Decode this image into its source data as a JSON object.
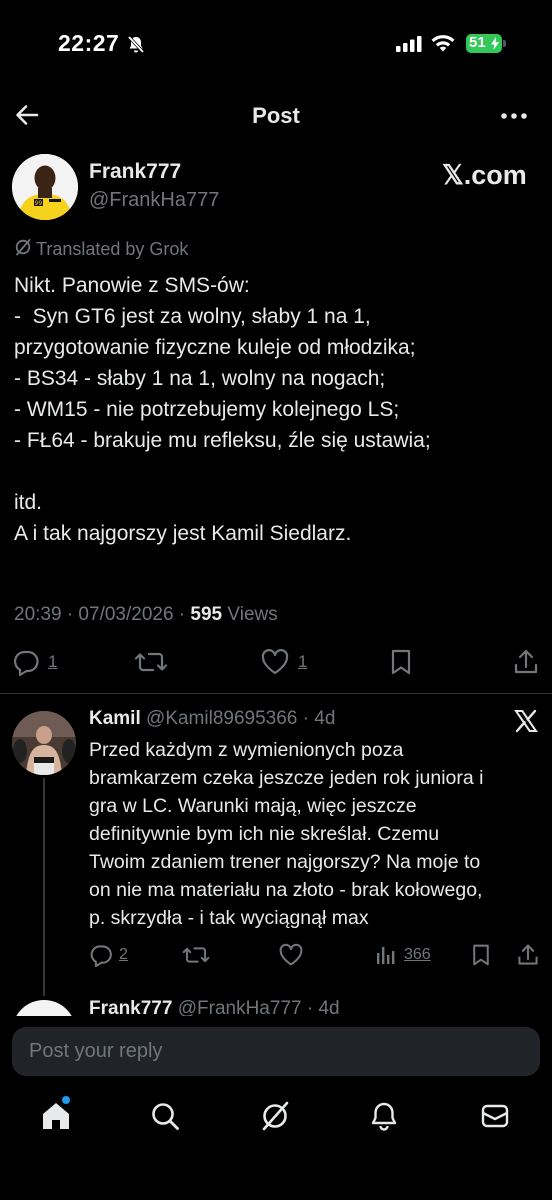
{
  "status_bar": {
    "time": "22:27",
    "battery": "51"
  },
  "header": {
    "title": "Post"
  },
  "post": {
    "author_name": "Frank777",
    "author_handle": "@FrankHa777",
    "source_badge": "𝕏.com",
    "translated_label": "Translated by Grok",
    "lines": [
      "Nikt. Panowie z SMS-ów:",
      "-  Syn GT6 jest za wolny, słaby 1 na 1,",
      "przygotowanie fizyczne kuleje od młodzika;",
      "- BS34 - słaby 1 na 1, wolny na nogach;",
      "- WM15 - nie potrzebujemy kolejnego LS;",
      "- FŁ64 - brakuje mu refleksu, źle się ustawia;",
      "",
      "itd.",
      "A i tak najgorszy jest Kamil Siedlarz."
    ],
    "timestamp": "20:39 · 07/03/2026 · ",
    "views_count": "595",
    "views_label": " Views",
    "reply_count": "1",
    "like_count": "1"
  },
  "reply": {
    "name": "Kamil",
    "handle_time": " @Kamil89695366 · 4d",
    "lines": [
      "Przed każdym z wymienionych poza",
      "bramkarzem czeka jeszcze jeden rok juniora i",
      "gra w LC. Warunki mają, więc jeszcze",
      "definitywnie bym ich nie skreślał. Czemu",
      "Twoim zdaniem trener najgorszy? Na moje to",
      "on nie ma materiału na złoto - brak kołowego,",
      "p. skrzydła - i tak wyciągnął max"
    ],
    "reply_count": "2",
    "views": "366"
  },
  "next_reply": {
    "name": "Frank777",
    "handle_time": " @FrankHa777 · 4d"
  },
  "composer": {
    "placeholder": "Post your reply"
  },
  "colors": {
    "background": "#000000",
    "text": "#e7e9ea",
    "muted": "#71767b",
    "accent": "#1d9bf0",
    "battery": "#34c759"
  },
  "icons": {
    "back": "arrow-left-icon",
    "more": "more-horizontal-icon",
    "reply": "reply-icon",
    "repost": "repost-icon",
    "like": "heart-icon",
    "bookmark": "bookmark-icon",
    "share": "share-icon",
    "views": "bar-chart-icon",
    "nav": [
      "home-icon",
      "search-icon",
      "grok-icon",
      "notifications-icon",
      "messages-icon"
    ]
  }
}
